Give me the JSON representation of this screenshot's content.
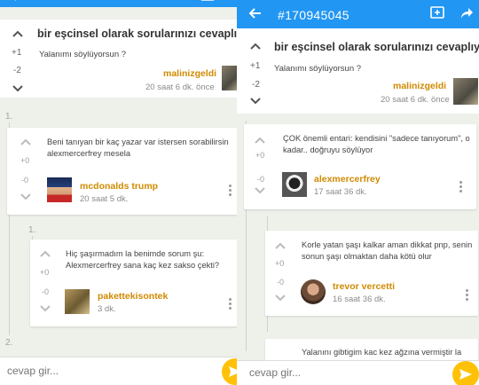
{
  "left": {
    "toolbar_id": "#170945045",
    "question": {
      "title": "bir eşcinsel olarak sorularınızı cevaplıyor",
      "body": "Yalanımı söylüyorsun ?",
      "upvotes": "+1",
      "downvotes": "-2",
      "author": "malinizgeldi",
      "time": "20 saat 6 dk. önce"
    },
    "comments": [
      {
        "index": "1.",
        "text": "Beni tanıyan bir kaç yazar var istersen sorabilirsin alexmercerfrey mesela",
        "upvotes": "+0",
        "downvotes": "-0",
        "author": "mcdonalds trump",
        "time": "20 saat 5 dk."
      },
      {
        "index": "1.",
        "text": "Hiç şaşırmadım la benimde sorum şu: Alexmercerfrey sana kaç kez sakso çekti?",
        "upvotes": "+0",
        "downvotes": "-0",
        "author": "pakettekisontek",
        "time": "3 dk."
      }
    ],
    "next_index": "2.",
    "reply_placeholder": "cevap gir..."
  },
  "right": {
    "toolbar_id": "#170945045",
    "question": {
      "title": "bir eşcinsel olarak sorularınızı cevaplıyo...",
      "body": "Yalanımı söylüyorsun ?",
      "upvotes": "+1",
      "downvotes": "-2",
      "author": "malinizgeldi",
      "time": "20 saat 6 dk. önce"
    },
    "comments": [
      {
        "text": "ÇOK önemli entari: kendisini \"sadece tanıyorum\", o kadar.. doğruyu söylüyor",
        "upvotes": "+0",
        "downvotes": "-0",
        "author": "alexmercerfrey",
        "time": "17 saat 36 dk."
      },
      {
        "index": "1.",
        "text": "Korle yatan şaşı kalkar aman dikkat pnp, senin sonun şaşı olmaktan daha kötü olur",
        "upvotes": "+0",
        "downvotes": "-0",
        "author": "trevor vercetti",
        "time": "16 saat 36 dk."
      },
      {
        "text": "Yalanını gibtigim kac kez ağzına vermiştir la"
      }
    ],
    "reply_placeholder": "cevap gir..."
  },
  "colors": {
    "appbar": "#2196f3",
    "author": "#d08a00",
    "send": "#ffc107"
  },
  "icons": [
    "back-arrow-icon",
    "add-comment-icon",
    "share-icon",
    "chevron-up-icon",
    "chevron-down-icon",
    "more-vert-icon",
    "send-icon"
  ]
}
